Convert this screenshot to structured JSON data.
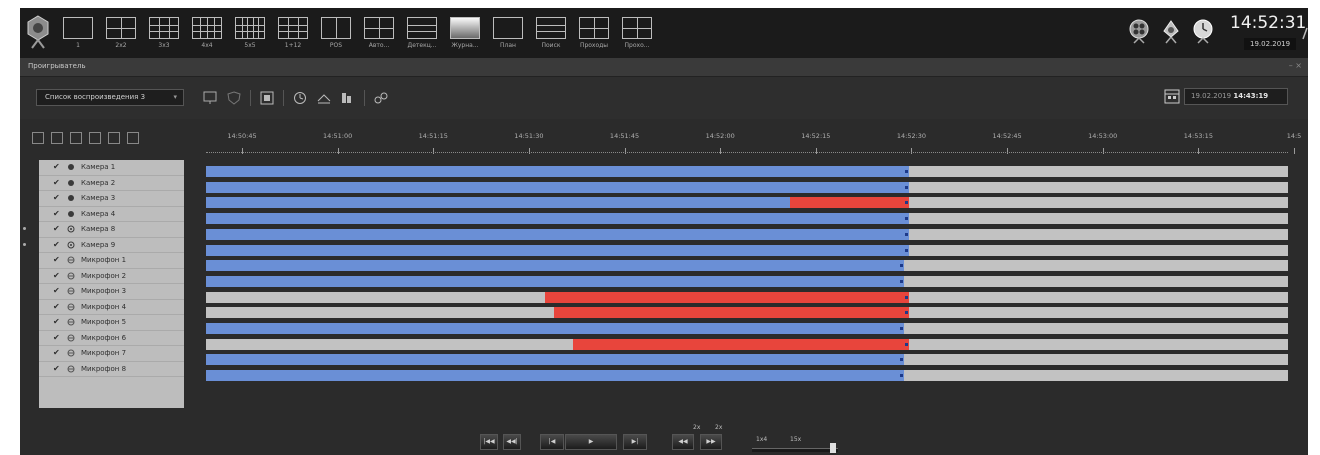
{
  "topbar": {
    "layouts": [
      {
        "label": "1",
        "icon": "layout-1-icon",
        "cols": 1,
        "rows": 1
      },
      {
        "label": "2x2",
        "icon": "layout-2x2-icon",
        "cols": 2,
        "rows": 2
      },
      {
        "label": "3x3",
        "icon": "layout-3x3-icon",
        "cols": 3,
        "rows": 3
      },
      {
        "label": "4x4",
        "icon": "layout-4x4-icon",
        "cols": 4,
        "rows": 3
      },
      {
        "label": "5x5",
        "icon": "layout-5x5-icon",
        "cols": 5,
        "rows": 3
      },
      {
        "label": "1+12",
        "icon": "layout-1-12-icon",
        "cols": 3,
        "rows": 3
      },
      {
        "label": "POS",
        "icon": "pos-icon",
        "cols": 2,
        "rows": 1
      },
      {
        "label": "Авто...",
        "icon": "auto-icon",
        "cols": 2,
        "rows": 2
      },
      {
        "label": "Детекц...",
        "icon": "detection-icon",
        "cols": 1,
        "rows": 3
      },
      {
        "label": "Журна...",
        "icon": "journal-icon",
        "cols": 0,
        "rows": 0,
        "gradient": true
      },
      {
        "label": "План",
        "icon": "plan-icon",
        "cols": 1,
        "rows": 1
      },
      {
        "label": "Поиск",
        "icon": "search-icon",
        "cols": 1,
        "rows": 3
      },
      {
        "label": "Проходы",
        "icon": "passes-icon",
        "cols": 2,
        "rows": 2
      },
      {
        "label": "Прохо...",
        "icon": "passes-icon",
        "cols": 2,
        "rows": 2
      }
    ],
    "time": "14:52:31",
    "date": "19.02.2019"
  },
  "window": {
    "title": "Проигрыватель",
    "controls": "– ×"
  },
  "toolbar": {
    "playlist": "Список воспроизведения 3",
    "datetime_date": "19.02.2019",
    "datetime_time": "14:43:19"
  },
  "timeline": {
    "ticks": [
      "14:50:45",
      "14:51:00",
      "14:51:15",
      "14:51:30",
      "14:51:45",
      "14:52:00",
      "14:52:15",
      "14:52:30",
      "14:52:45",
      "14:53:00",
      "14:53:15",
      "14:5"
    ]
  },
  "channels": [
    {
      "name": "Камера 1",
      "type": "camera",
      "checked": true,
      "dot": false
    },
    {
      "name": "Камера 2",
      "type": "camera",
      "checked": true,
      "dot": false
    },
    {
      "name": "Камера 3",
      "type": "camera",
      "checked": true,
      "dot": false
    },
    {
      "name": "Камера 4",
      "type": "camera",
      "checked": true,
      "dot": false
    },
    {
      "name": "Камера 8",
      "type": "camera2",
      "checked": true,
      "dot": true
    },
    {
      "name": "Камера 9",
      "type": "camera2",
      "checked": true,
      "dot": true
    },
    {
      "name": "Микрофон 1",
      "type": "mic",
      "checked": true,
      "dot": false
    },
    {
      "name": "Микрофон 2",
      "type": "mic",
      "checked": true,
      "dot": false
    },
    {
      "name": "Микрофон 3",
      "type": "mic",
      "checked": true,
      "dot": false
    },
    {
      "name": "Микрофон 4",
      "type": "mic",
      "checked": true,
      "dot": false
    },
    {
      "name": "Микрофон 5",
      "type": "mic",
      "checked": true,
      "dot": false
    },
    {
      "name": "Микрофон 6",
      "type": "mic",
      "checked": true,
      "dot": false
    },
    {
      "name": "Микрофон 7",
      "type": "mic",
      "checked": true,
      "dot": false
    },
    {
      "name": "Микрофон 8",
      "type": "mic",
      "checked": true,
      "dot": false
    }
  ],
  "tracks": [
    {
      "segments": [
        {
          "kind": "normal",
          "start": 0.0,
          "end": 0.65
        }
      ]
    },
    {
      "segments": [
        {
          "kind": "normal",
          "start": 0.0,
          "end": 0.65
        }
      ]
    },
    {
      "segments": [
        {
          "kind": "normal",
          "start": 0.0,
          "end": 0.54
        },
        {
          "kind": "alarm",
          "start": 0.54,
          "end": 0.65
        }
      ]
    },
    {
      "segments": [
        {
          "kind": "normal",
          "start": 0.0,
          "end": 0.65
        }
      ]
    },
    {
      "segments": [
        {
          "kind": "normal",
          "start": 0.0,
          "end": 0.65
        }
      ]
    },
    {
      "segments": [
        {
          "kind": "normal",
          "start": 0.0,
          "end": 0.65
        }
      ]
    },
    {
      "segments": [
        {
          "kind": "normal",
          "start": 0.0,
          "end": 0.645
        }
      ]
    },
    {
      "segments": [
        {
          "kind": "normal",
          "start": 0.0,
          "end": 0.645
        }
      ]
    },
    {
      "segments": [
        {
          "kind": "alarm",
          "start": 0.313,
          "end": 0.65
        }
      ]
    },
    {
      "segments": [
        {
          "kind": "alarm",
          "start": 0.322,
          "end": 0.65
        }
      ]
    },
    {
      "segments": [
        {
          "kind": "normal",
          "start": 0.0,
          "end": 0.645
        }
      ]
    },
    {
      "segments": [
        {
          "kind": "alarm",
          "start": 0.339,
          "end": 0.65
        }
      ]
    },
    {
      "segments": [
        {
          "kind": "normal",
          "start": 0.0,
          "end": 0.645
        }
      ]
    },
    {
      "segments": [
        {
          "kind": "normal",
          "start": 0.0,
          "end": 0.645
        }
      ]
    }
  ],
  "colors": {
    "normal": "#6a8fd6",
    "alarm": "#e8453c",
    "track_bg": "#c2c2c2"
  },
  "controls": {
    "buttons": [
      {
        "name": "first-frame-button",
        "label": "|◀◀"
      },
      {
        "name": "prev-segment-button",
        "label": "◀◀|"
      },
      {
        "name": "step-back-button",
        "label": "|◀"
      },
      {
        "name": "play-button",
        "label": "▶"
      },
      {
        "name": "step-forward-button",
        "label": "▶|"
      },
      {
        "name": "slow-button",
        "label": "◀◀"
      },
      {
        "name": "fast-button",
        "label": "▶▶"
      }
    ],
    "slow_rate": "2x",
    "fast_rate": "2x",
    "speed_label_left": "1x4",
    "speed_label_right": "15x",
    "speed_position": 0.95
  }
}
